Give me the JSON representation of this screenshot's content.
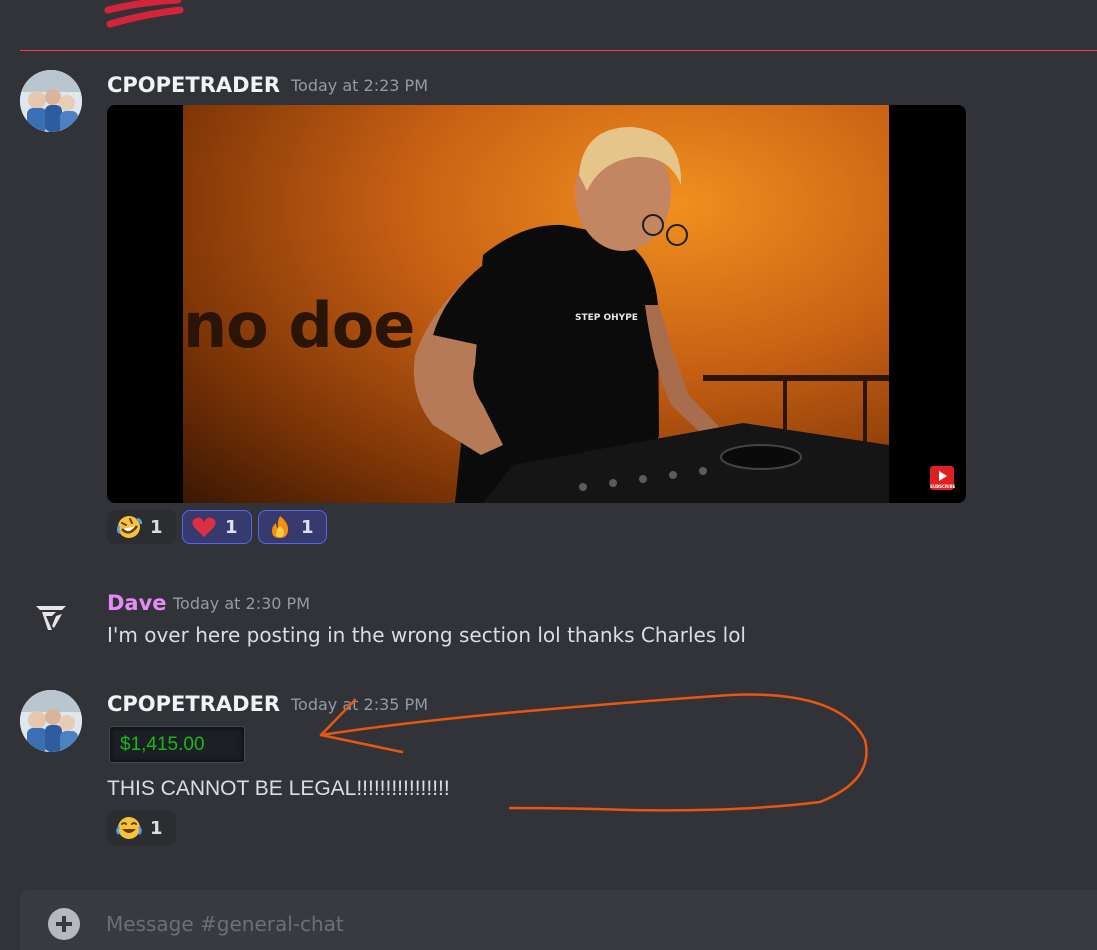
{
  "messages": [
    {
      "author": "CPOPETRADER",
      "timestamp": "Today at 2:23 PM",
      "author_color": "#f2f3f5",
      "video": {
        "wall_text": "no doe",
        "shirt_text": "STEP OHYPE",
        "badge_label": "SUBSCRIBE"
      },
      "reactions": [
        {
          "emoji": "rofl-emoji",
          "count": "1",
          "me": false
        },
        {
          "emoji": "heart-emoji",
          "count": "1",
          "me": true
        },
        {
          "emoji": "fire-emoji",
          "count": "1",
          "me": true
        }
      ]
    },
    {
      "author": "Dave",
      "timestamp": "Today at 2:30 PM",
      "author_color": "#e38cf5",
      "text": "I'm over here posting in the wrong section lol thanks Charles lol"
    },
    {
      "author": "CPOPETRADER",
      "timestamp": "Today at 2:35 PM",
      "author_color": "#f2f3f5",
      "price": "$1,415.00",
      "text": "THIS CANNOT BE LEGAL!!!!!!!!!!!!!!!!",
      "reactions": [
        {
          "emoji": "joy-emoji",
          "count": "1",
          "me": false
        }
      ]
    }
  ],
  "composer": {
    "placeholder": "Message #general-chat"
  },
  "colors": {
    "background": "#313338",
    "divider": "#f23f43",
    "timestamp": "#949ba4",
    "annotation": "#e8560f",
    "price_green": "#19b719"
  }
}
